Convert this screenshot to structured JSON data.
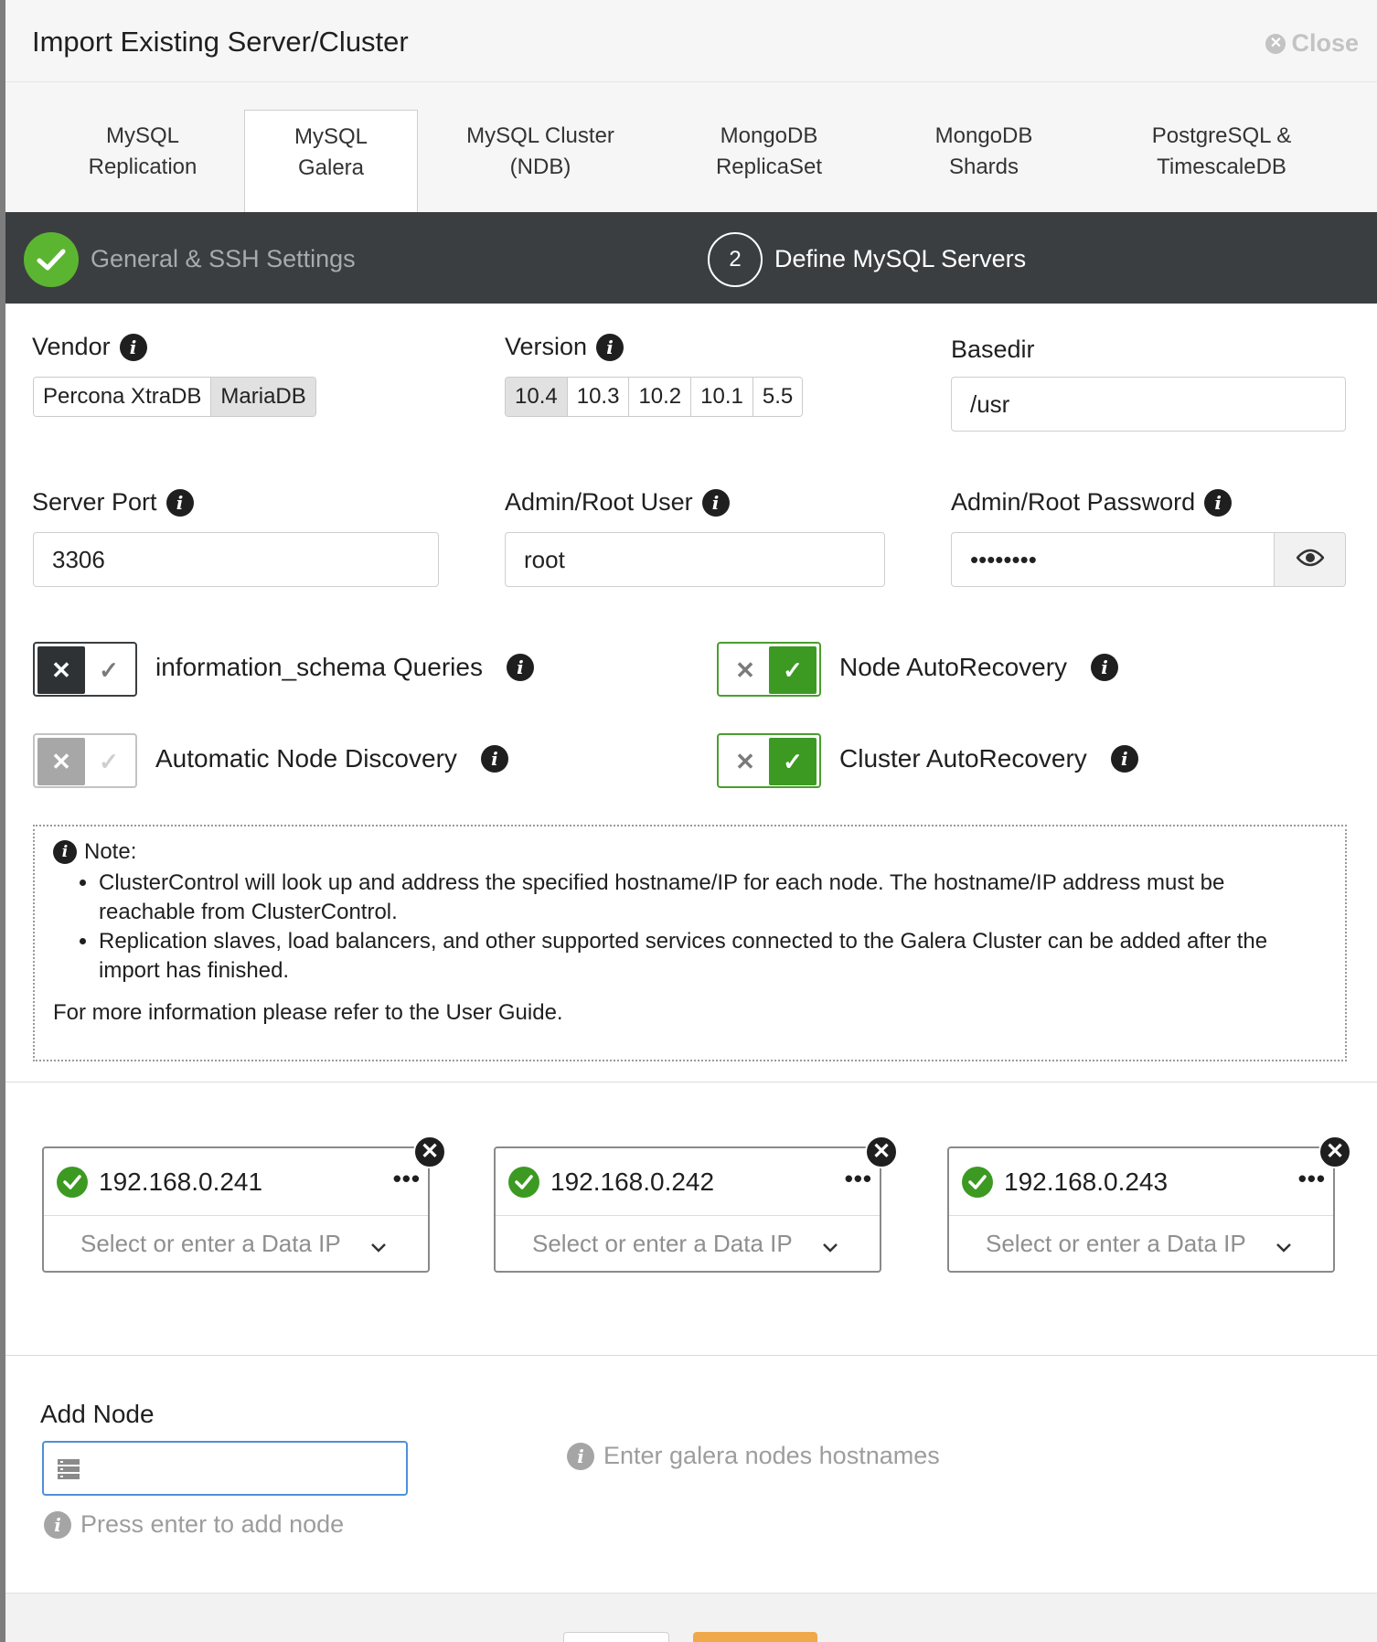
{
  "dialog": {
    "title": "Import Existing Server/Cluster",
    "close_label": "Close"
  },
  "tabs": [
    {
      "line1": "MySQL",
      "line2": "Replication"
    },
    {
      "line1": "MySQL",
      "line2": "Galera"
    },
    {
      "line1": "MySQL Cluster",
      "line2": "(NDB)"
    },
    {
      "line1": "MongoDB",
      "line2": "ReplicaSet"
    },
    {
      "line1": "MongoDB",
      "line2": "Shards"
    },
    {
      "line1": "PostgreSQL &",
      "line2": "TimescaleDB"
    }
  ],
  "active_tab": "MySQL Galera",
  "steps": {
    "step1": {
      "label": "General & SSH Settings",
      "state": "done"
    },
    "step2": {
      "number": "2",
      "label": "Define MySQL Servers",
      "state": "current"
    }
  },
  "form": {
    "vendor": {
      "label": "Vendor",
      "options": [
        "Percona XtraDB",
        "MariaDB"
      ],
      "selected": "MariaDB"
    },
    "version": {
      "label": "Version",
      "options": [
        "10.4",
        "10.3",
        "10.2",
        "10.1",
        "5.5"
      ],
      "selected": "10.4"
    },
    "basedir": {
      "label": "Basedir",
      "value": "/usr"
    },
    "server_port": {
      "label": "Server Port",
      "value": "3306"
    },
    "admin_user": {
      "label": "Admin/Root User",
      "value": "root"
    },
    "admin_password": {
      "label": "Admin/Root Password",
      "value": "••••••••"
    }
  },
  "toggles": {
    "info_schema": {
      "label": "information_schema Queries",
      "state": "off"
    },
    "node_discovery": {
      "label": "Automatic Node Discovery",
      "state": "disabled"
    },
    "node_autorecovery": {
      "label": "Node AutoRecovery",
      "state": "on"
    },
    "cluster_autorecovery": {
      "label": "Cluster AutoRecovery",
      "state": "on"
    }
  },
  "note": {
    "heading": "Note:",
    "bullets": [
      "ClusterControl will look up and address the specified hostname/IP for each node. The hostname/IP address must be reachable from ClusterControl.",
      "Replication slaves, load balancers, and other supported services connected to the Galera Cluster can be added after the import has finished."
    ],
    "footer": "For more information please refer to the User Guide."
  },
  "nodes": [
    {
      "ip": "192.168.0.241",
      "data_ip_placeholder": "Select or enter a Data IP"
    },
    {
      "ip": "192.168.0.242",
      "data_ip_placeholder": "Select or enter a Data IP"
    },
    {
      "ip": "192.168.0.243",
      "data_ip_placeholder": "Select or enter a Data IP"
    }
  ],
  "add_node": {
    "label": "Add Node",
    "value": "",
    "hint": "Press enter to add node",
    "side_hint": "Enter galera nodes hostnames"
  },
  "colors": {
    "success": "#3c9a22",
    "step_bar": "#3b3e41",
    "primary_footer": "#f0a94a"
  }
}
